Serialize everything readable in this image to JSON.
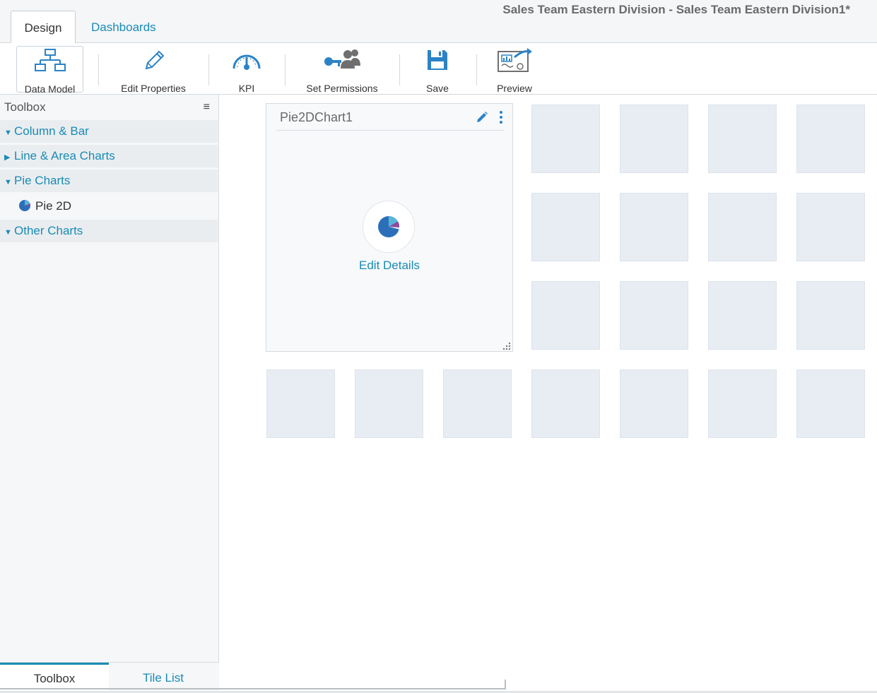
{
  "top_tabs": [
    {
      "label": "Design",
      "active": true
    },
    {
      "label": "Dashboards",
      "active": false
    }
  ],
  "document_title": "Sales Team Eastern Division - Sales Team Eastern Division1*",
  "ribbon": {
    "buttons": [
      {
        "label": "Data Model",
        "icon": "data-model-icon",
        "selected": true
      },
      {
        "label": "Edit Properties",
        "icon": "pencil-icon"
      },
      {
        "label": "KPI",
        "icon": "gauge-icon"
      },
      {
        "label": "Set Permissions",
        "icon": "permissions-icon"
      },
      {
        "label": "Save",
        "icon": "floppy-disk-icon"
      },
      {
        "label": "Preview",
        "icon": "preview-icon"
      }
    ]
  },
  "sidebar": {
    "header": "Toolbox",
    "menu_icon": "hamburger-icon",
    "categories": [
      {
        "label": "Column & Bar",
        "expanded": true
      },
      {
        "label": "Line & Area Charts",
        "expanded": false
      },
      {
        "label": "Pie Charts",
        "expanded": true,
        "items": [
          {
            "label": "Pie 2D",
            "icon": "pie-chart-icon"
          }
        ]
      },
      {
        "label": "Other Charts",
        "expanded": true
      }
    ],
    "bottom_tabs": [
      {
        "label": "Toolbox",
        "active": true
      },
      {
        "label": "Tile List",
        "active": false
      }
    ]
  },
  "canvas": {
    "tile": {
      "title": "Pie2DChart1",
      "link": "Edit Details"
    }
  },
  "colors": {
    "accent": "#1a8bb5",
    "icon_blue": "#2b83c6",
    "placeholder_cell": "#e7edf3"
  }
}
